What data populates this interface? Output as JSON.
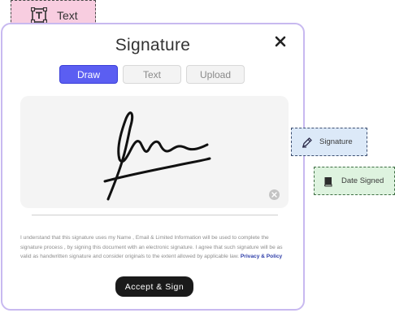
{
  "text_field_tag": {
    "label": "Text",
    "icon": "text-box-icon",
    "color": "#f8cde0"
  },
  "modal": {
    "title": "Signature",
    "close_icon": "close-icon",
    "border_color": "#c8b9f0",
    "tabs": [
      {
        "label": "Draw",
        "active": true
      },
      {
        "label": "Text",
        "active": false
      },
      {
        "label": "Upload",
        "active": false
      }
    ],
    "accent": "#5b5ef2",
    "pad": {
      "clear_icon": "clear-circle-icon"
    },
    "legal_text": "I understand that this signature uses my Name , Email & Limited Information will be used to complete the signature process , by signing this document with an electronic signature. I agree that such signature will be as valid as handwritten signature and consider originals to the extent allowed by applicable law.",
    "legal_link": "Privacy & Policy",
    "accept_label": "Accept  &  Sign"
  },
  "signature_field_tag": {
    "label": "Signature",
    "icon": "pen-icon",
    "color": "#dce9f8"
  },
  "date_field_tag": {
    "label": "Date Signed",
    "icon": "book-icon",
    "color": "#def3df"
  }
}
